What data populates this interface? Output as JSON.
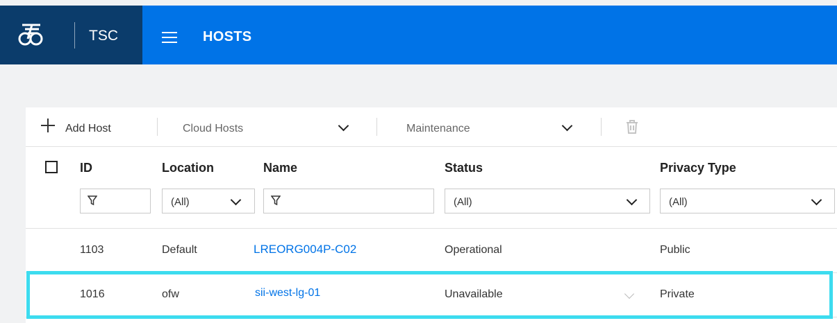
{
  "header": {
    "logo_icon": "brand-logo-icon",
    "app_name": "TSC",
    "menu_icon": "hamburger-menu-icon",
    "page_title": "HOSTS",
    "brand_color": "#0073e7",
    "logo_bg_color": "#0b3c6b"
  },
  "toolbar": {
    "add_host_label": "Add Host",
    "add_icon": "plus-icon",
    "cloud_hosts_label": "Cloud Hosts",
    "maintenance_label": "Maintenance",
    "dropdown_icon": "chevron-down-icon",
    "delete_icon": "trash-icon"
  },
  "table": {
    "columns": {
      "id": "ID",
      "location": "Location",
      "name": "Name",
      "status": "Status",
      "privacy_type": "Privacy Type"
    },
    "filters": {
      "location": "(All)",
      "status": "(All)",
      "privacy_type": "(All)",
      "filter_icon": "funnel-icon"
    },
    "rows": [
      {
        "id": "1103",
        "location": "Default",
        "name": "LREORG004P-C02",
        "status": "Operational",
        "privacy_type": "Public"
      },
      {
        "id": "1016",
        "location": "ofw",
        "name": "sii-west-lg-01",
        "status": "Unavailable",
        "privacy_type": "Private",
        "highlighted": true
      }
    ],
    "link_color": "#0073e7",
    "highlight_color": "#3ddcef"
  }
}
